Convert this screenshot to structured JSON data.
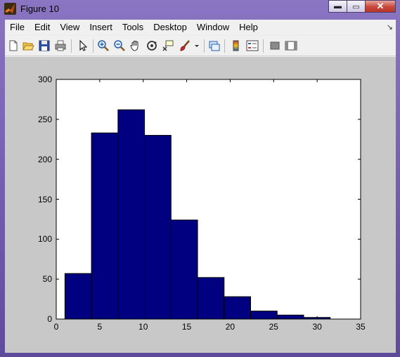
{
  "window": {
    "title": "Figure 10",
    "controls": {
      "minimize": "▬",
      "maximize": "▭",
      "close": "✕"
    }
  },
  "menu": {
    "items": [
      "File",
      "Edit",
      "View",
      "Insert",
      "Tools",
      "Desktop",
      "Window",
      "Help"
    ],
    "dock_arrow": "↘"
  },
  "toolbar": {
    "icons": [
      "new-figure-icon",
      "open-file-icon",
      "save-icon",
      "print-icon",
      "edit-plot-arrow-icon",
      "zoom-in-icon",
      "zoom-out-icon",
      "pan-hand-icon",
      "rotate-3d-icon",
      "data-cursor-icon",
      "brush-icon",
      "brush-dropdown-icon",
      "link-plot-icon",
      "colorbar-icon",
      "legend-icon",
      "hide-plot-tools-icon",
      "show-plot-tools-icon"
    ]
  },
  "colors": {
    "bar_fill": "#000080",
    "figure_bg": "#c8c8c8",
    "axes_bg": "#ffffff"
  },
  "chart_data": {
    "type": "bar",
    "title": "",
    "xlabel": "",
    "ylabel": "",
    "xlim": [
      0,
      35
    ],
    "ylim": [
      0,
      300
    ],
    "xticks": [
      0,
      5,
      10,
      15,
      20,
      25,
      30,
      35
    ],
    "yticks": [
      0,
      50,
      100,
      150,
      200,
      250,
      300
    ],
    "bin_edges": [
      1,
      4.05,
      7.1,
      10.15,
      13.2,
      16.25,
      19.3,
      22.35,
      25.4,
      28.45,
      31.5
    ],
    "values": [
      57,
      233,
      262,
      230,
      124,
      52,
      28,
      10,
      5,
      2
    ],
    "grid": false
  }
}
